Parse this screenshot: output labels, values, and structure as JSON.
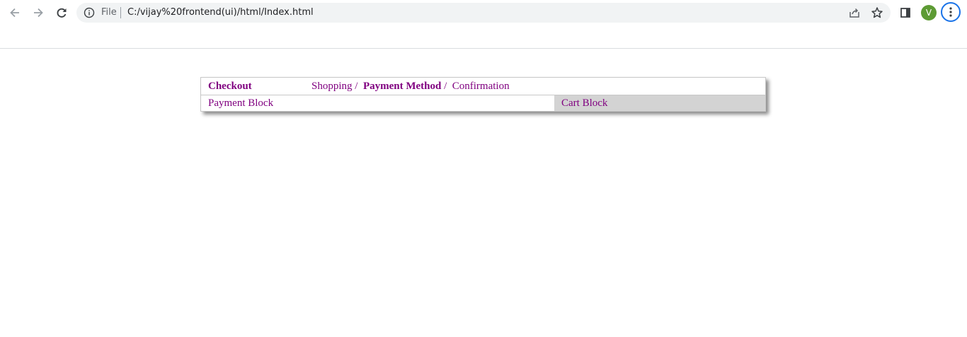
{
  "browser": {
    "address_label": "File",
    "url": "C:/vijay%20frontend(ui)/html/Index.html",
    "profile_initial": "V"
  },
  "checkout": {
    "title": "Checkout",
    "breadcrumbs": [
      {
        "label": "Shopping",
        "separator": "/"
      },
      {
        "label": "Payment Method",
        "separator": "/"
      },
      {
        "label": "Confirmation"
      }
    ],
    "payment_block_label": "Payment Block",
    "cart_block_label": "Cart Block"
  },
  "colors": {
    "text": "#800080",
    "cart_background": "#d3d3d3",
    "avatar": "#5d9b34",
    "menu_ring": "#1a73e8"
  }
}
